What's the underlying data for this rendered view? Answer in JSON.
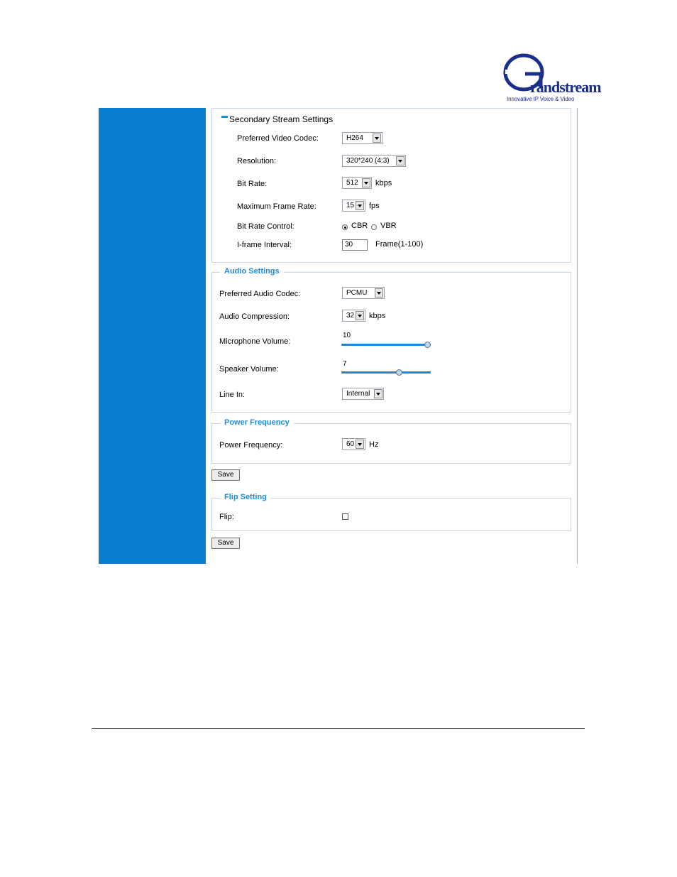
{
  "logo": {
    "brand": "Grandstream",
    "tagline": "Innovative IP Voice & Video"
  },
  "secondary_stream": {
    "title": "Secondary Stream Settings",
    "codec_label": "Preferred Video Codec:",
    "codec_value": "H264",
    "resolution_label": "Resolution:",
    "resolution_value": "320*240 (4:3)",
    "bitrate_label": "Bit Rate:",
    "bitrate_value": "512",
    "bitrate_unit": "kbps",
    "framerate_label": "Maximum Frame Rate:",
    "framerate_value": "15",
    "framerate_unit": "fps",
    "bitrate_control_label": "Bit Rate Control:",
    "cbr_label": "CBR",
    "vbr_label": "VBR",
    "selected_control": "CBR",
    "iframe_label": "I-frame Interval:",
    "iframe_value": "30",
    "iframe_hint": "Frame(1-100)"
  },
  "audio": {
    "legend": "Audio Settings",
    "codec_label": "Preferred Audio Codec:",
    "codec_value": "PCMU",
    "compression_label": "Audio Compression:",
    "compression_value": "32",
    "compression_unit": "kbps",
    "mic_label": "Microphone Volume:",
    "mic_value": "10",
    "mic_level": 1.0,
    "speaker_label": "Speaker Volume:",
    "speaker_value": "7",
    "speaker_level": 0.66,
    "linein_label": "Line In:",
    "linein_value": "Internal"
  },
  "power": {
    "legend": "Power Frequency",
    "freq_label": "Power Frequency:",
    "freq_value": "60",
    "freq_unit": "Hz",
    "save_label": "Save"
  },
  "flip": {
    "legend": "Flip Setting",
    "flip_label": "Flip:",
    "flip_checked": false,
    "save_label": "Save"
  },
  "colors": {
    "sidebar": "#0a7fd2",
    "legend": "#1f8dd6",
    "slider": "#1e88d6"
  }
}
